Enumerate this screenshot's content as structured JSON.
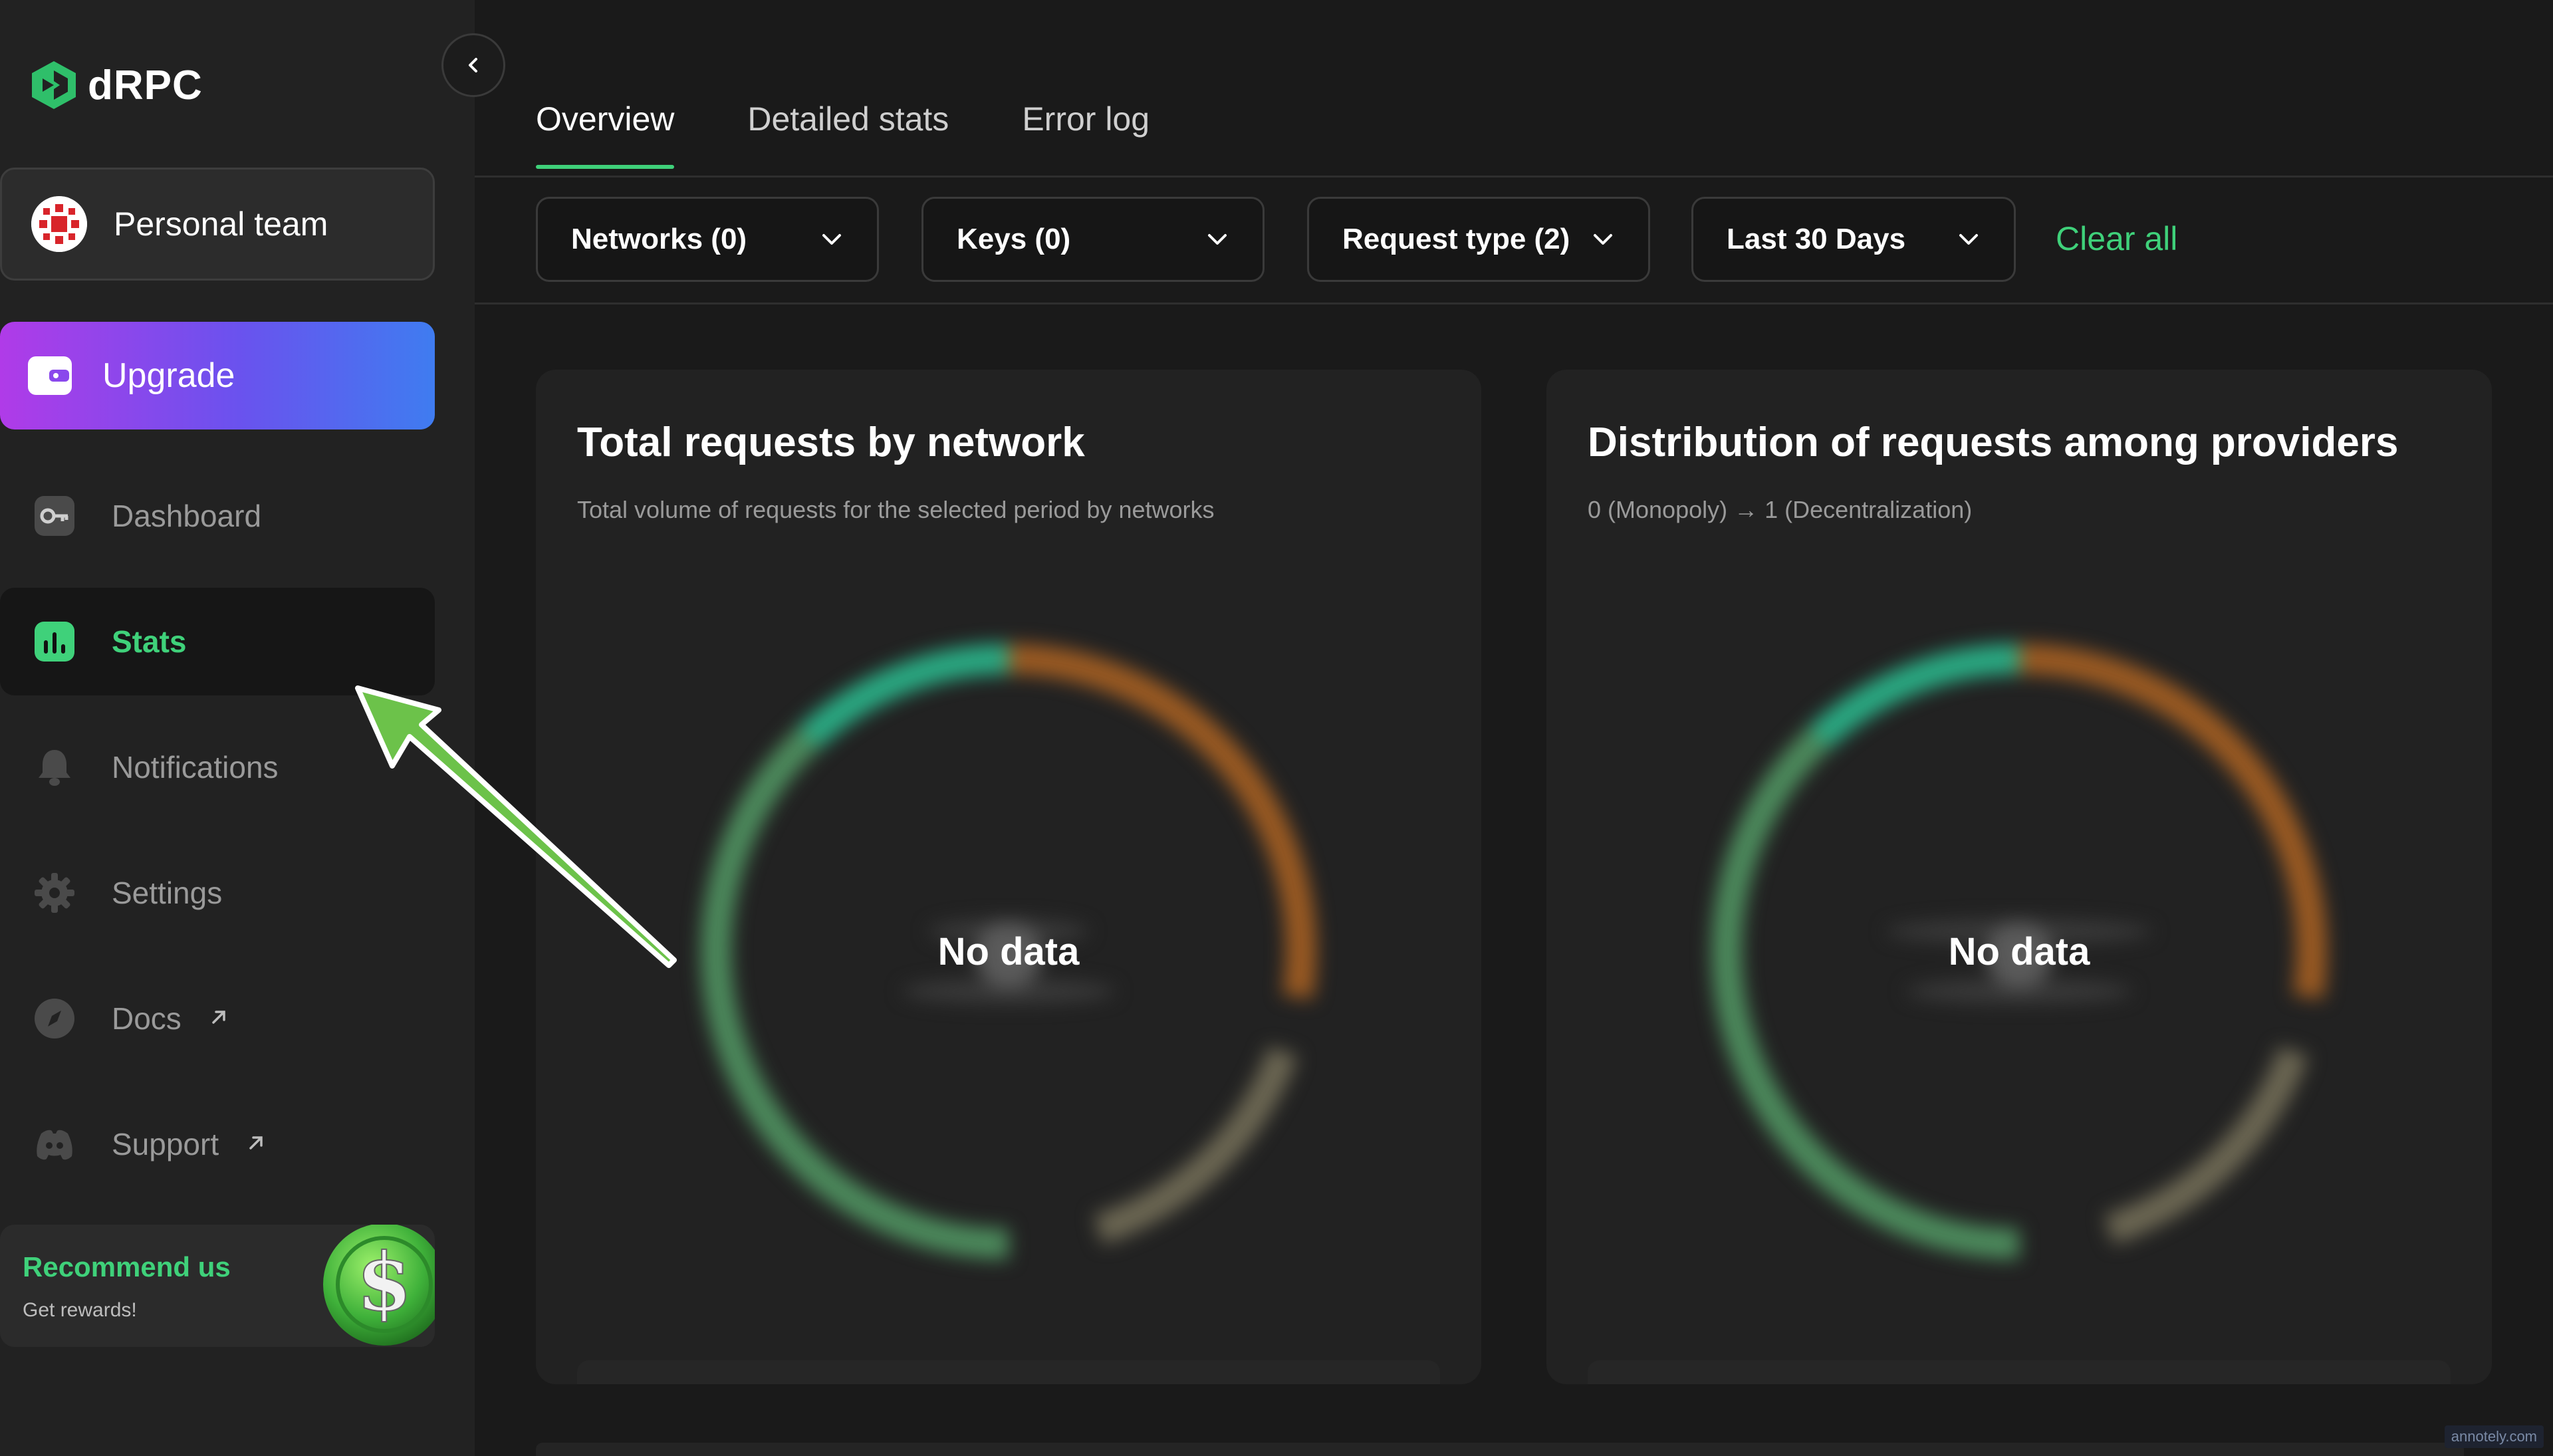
{
  "brand": {
    "name": "dRPC",
    "accent": "#3fd17a"
  },
  "sidebar": {
    "team": {
      "label": "Personal team",
      "icon": "team-avatar-icon"
    },
    "upgrade": {
      "label": "Upgrade",
      "icon": "wallet-icon"
    },
    "items": [
      {
        "label": "Dashboard",
        "icon": "key-icon",
        "active": false,
        "external": false
      },
      {
        "label": "Stats",
        "icon": "bar-chart-icon",
        "active": true,
        "external": false
      },
      {
        "label": "Notifications",
        "icon": "bell-icon",
        "active": false,
        "external": false
      },
      {
        "label": "Settings",
        "icon": "gear-icon",
        "active": false,
        "external": false
      },
      {
        "label": "Docs",
        "icon": "compass-icon",
        "active": false,
        "external": true
      },
      {
        "label": "Support",
        "icon": "discord-icon",
        "active": false,
        "external": true
      }
    ],
    "recommend": {
      "title": "Recommend us",
      "subtitle": "Get rewards!"
    }
  },
  "tabs": [
    {
      "label": "Overview",
      "active": true
    },
    {
      "label": "Detailed stats",
      "active": false
    },
    {
      "label": "Error log",
      "active": false
    }
  ],
  "filters": {
    "networks": "Networks (0)",
    "keys": "Keys (0)",
    "request_type": "Request type (2)",
    "period": "Last 30 Days",
    "clear_all": "Clear all"
  },
  "cards": [
    {
      "title": "Total requests by network",
      "subtitle": "Total volume of requests for the selected period by networks",
      "empty_label": "No data"
    },
    {
      "title": "Distribution of requests among providers",
      "subtitle": "0 (Monopoly) → 1 (Decentralization)",
      "empty_label": "No data"
    }
  ],
  "watermark": "annotely.com"
}
